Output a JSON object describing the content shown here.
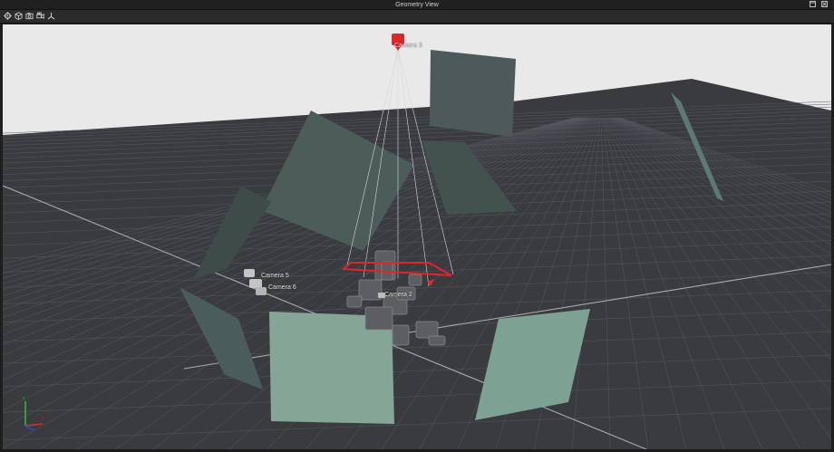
{
  "window": {
    "title": "Geometry View"
  },
  "title_buttons": [
    {
      "name": "maximize-button",
      "icon": "maximize-icon"
    },
    {
      "name": "close-button",
      "icon": "close-icon"
    }
  ],
  "toolbar": {
    "tools": [
      {
        "name": "settings-button",
        "icon": "gear-icon"
      },
      {
        "name": "object-view-button",
        "icon": "cube-icon"
      },
      {
        "name": "screenshot-button",
        "icon": "camera-icon"
      },
      {
        "name": "camera-view-button",
        "icon": "video-camera-icon"
      },
      {
        "name": "axes-toggle-button",
        "icon": "axes-icon"
      }
    ]
  },
  "scene": {
    "cameras": [
      {
        "label": "Camera 3",
        "selected": true
      },
      {
        "label": "Camera 5",
        "selected": false
      },
      {
        "label": "Camera 6",
        "selected": false
      },
      {
        "label": "Camera 2",
        "selected": false
      }
    ],
    "axis_labels": {
      "y": "Y",
      "x": "X"
    },
    "colors": {
      "background_sky": "#e9e9e9",
      "floor": "#3a3b3f",
      "grid_line": "#565963",
      "panel": "#4b5c59",
      "panel_light": "#85a597",
      "selection": "#e0262b",
      "axis_y": "#2fbf3a",
      "axis_x": "#d6312b",
      "axis_z": "#2b4fd8"
    }
  }
}
